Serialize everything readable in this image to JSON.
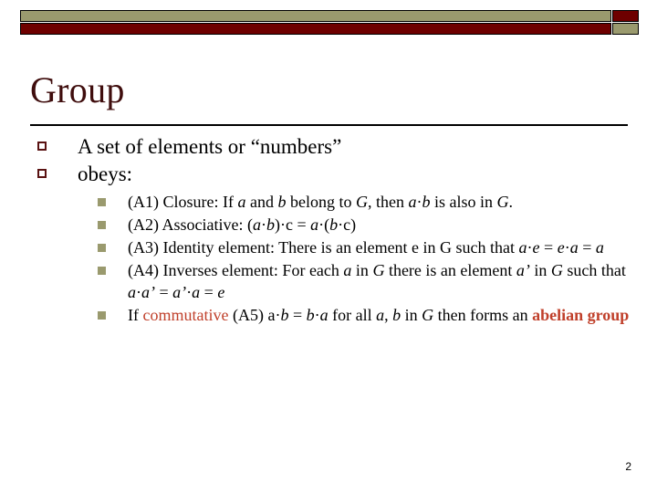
{
  "slide": {
    "title": "Group",
    "page_number": "2",
    "colors": {
      "bar_olive": "#9A9A6E",
      "bar_dark_red": "#6E0000",
      "title_text": "#3F0D0D",
      "bullet1_outline": "#5A1212",
      "bullet2_fill": "#9A9A6E",
      "highlight": "#C0402B",
      "rule": "#000000",
      "background": "#FFFFFF"
    },
    "decor": {
      "top_bar_label": "olive-bar",
      "bottom_bar_label": "dark-red-bar",
      "corner_top_right_label": "dark-red-square",
      "corner_bottom_right_label": "olive-square"
    },
    "bullets": [
      {
        "text": "A set of elements or “numbers”"
      },
      {
        "text": "obeys:"
      }
    ],
    "axioms": [
      {
        "id": "A1",
        "parts": [
          {
            "t": "(A1) Closure: If ",
            "style": "plain"
          },
          {
            "t": "a",
            "style": "italic"
          },
          {
            "t": " and ",
            "style": "plain"
          },
          {
            "t": "b",
            "style": "italic"
          },
          {
            "t": " belong to ",
            "style": "plain"
          },
          {
            "t": "G",
            "style": "italic"
          },
          {
            "t": ", then ",
            "style": "plain"
          },
          {
            "t": "a",
            "style": "italic"
          },
          {
            "t": "·",
            "style": "plain"
          },
          {
            "t": "b",
            "style": "italic"
          },
          {
            "t": " is also in ",
            "style": "plain"
          },
          {
            "t": "G",
            "style": "italic"
          },
          {
            "t": ".",
            "style": "plain"
          }
        ],
        "plain": "(A1) Closure: If a and b belong to G, then a·b is also in G."
      },
      {
        "id": "A2",
        "parts": [
          {
            "t": "(A2) Associative: (",
            "style": "plain"
          },
          {
            "t": "a",
            "style": "italic"
          },
          {
            "t": "·",
            "style": "plain"
          },
          {
            "t": "b",
            "style": "italic"
          },
          {
            "t": ")·c  =  ",
            "style": "plain"
          },
          {
            "t": "a",
            "style": "italic"
          },
          {
            "t": "·(",
            "style": "plain"
          },
          {
            "t": "b",
            "style": "italic"
          },
          {
            "t": "·c)",
            "style": "plain"
          }
        ],
        "plain": "(A2) Associative: (a·b)·c  =  a·(b·c)"
      },
      {
        "id": "A3",
        "parts": [
          {
            "t": "(A3) Identity element: There is an element e in G such that ",
            "style": "plain"
          },
          {
            "t": "a",
            "style": "italic"
          },
          {
            "t": "·",
            "style": "plain"
          },
          {
            "t": "e",
            "style": "italic"
          },
          {
            "t": " = ",
            "style": "plain"
          },
          {
            "t": "e",
            "style": "italic"
          },
          {
            "t": "·",
            "style": "plain"
          },
          {
            "t": "a",
            "style": "italic"
          },
          {
            "t": " = ",
            "style": "plain"
          },
          {
            "t": "a",
            "style": "italic"
          }
        ],
        "plain": "(A3) Identity element: There is an element e in G such that a·e = e·a = a"
      },
      {
        "id": "A4",
        "parts": [
          {
            "t": "(A4) Inverses element: For each ",
            "style": "plain"
          },
          {
            "t": "a",
            "style": "italic"
          },
          {
            "t": " in ",
            "style": "plain"
          },
          {
            "t": "G",
            "style": "italic"
          },
          {
            "t": " there is an element ",
            "style": "plain"
          },
          {
            "t": "a’",
            "style": "italic"
          },
          {
            "t": " in ",
            "style": "plain"
          },
          {
            "t": "G",
            "style": "italic"
          },
          {
            "t": " such that ",
            "style": "plain"
          },
          {
            "t": "a",
            "style": "italic"
          },
          {
            "t": "·",
            "style": "plain"
          },
          {
            "t": "a’",
            "style": "italic"
          },
          {
            "t": " = ",
            "style": "plain"
          },
          {
            "t": "a’",
            "style": "italic"
          },
          {
            "t": "·",
            "style": "plain"
          },
          {
            "t": "a",
            "style": "italic"
          },
          {
            "t": " = ",
            "style": "plain"
          },
          {
            "t": "e",
            "style": "italic"
          }
        ],
        "plain": "(A4) Inverses element: For each a in G there is an element a’ in G such that a·a’ = a’·a = e"
      },
      {
        "id": "A5",
        "parts": [
          {
            "t": "If ",
            "style": "plain"
          },
          {
            "t": "commutative",
            "style": "highlight"
          },
          {
            "t": " (A5)  a·",
            "style": "plain"
          },
          {
            "t": "b",
            "style": "italic"
          },
          {
            "t": " = ",
            "style": "plain"
          },
          {
            "t": "b",
            "style": "italic"
          },
          {
            "t": "·",
            "style": "plain"
          },
          {
            "t": "a",
            "style": "italic"
          },
          {
            "t": " for all ",
            "style": "plain"
          },
          {
            "t": "a",
            "style": "italic"
          },
          {
            "t": ", ",
            "style": "plain"
          },
          {
            "t": "b",
            "style": "italic"
          },
          {
            "t": " in ",
            "style": "plain"
          },
          {
            "t": "G",
            "style": "italic"
          },
          {
            "t": " then forms an ",
            "style": "plain"
          },
          {
            "t": "abelian group",
            "style": "highlight-bold"
          }
        ],
        "plain": "If commutative (A5)  a·b = b·a for all a, b in G then forms an abelian group"
      }
    ]
  }
}
